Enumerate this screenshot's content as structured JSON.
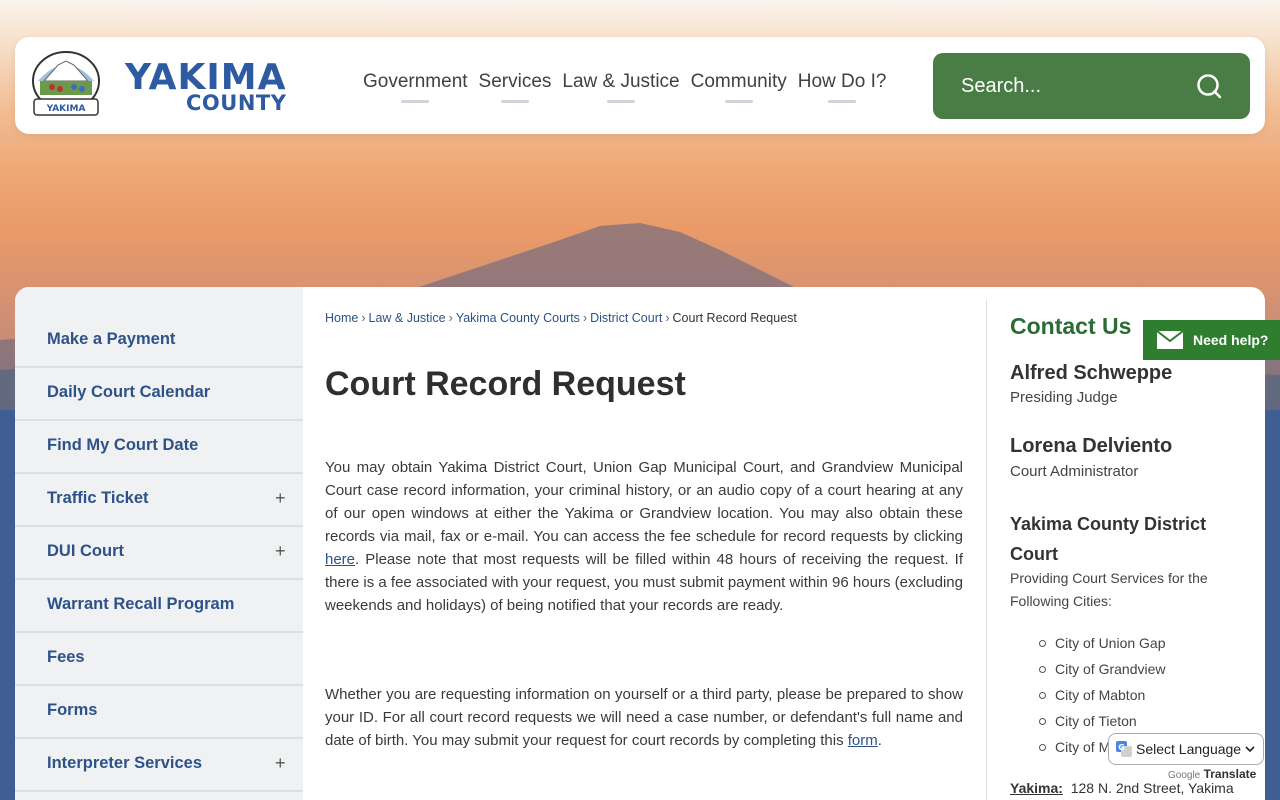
{
  "header": {
    "logo_word1": "YAKIMA",
    "logo_word2": "COUNTY",
    "logo_badge_text": "YAKIMA",
    "nav": [
      {
        "label": "Government"
      },
      {
        "label": "Services"
      },
      {
        "label": "Law & Justice"
      },
      {
        "label": "Community"
      },
      {
        "label": "How Do I?"
      }
    ],
    "search_placeholder": "Search..."
  },
  "sidebar": {
    "items": [
      {
        "label": "Make a Payment",
        "expandable": false
      },
      {
        "label": "Daily Court Calendar",
        "expandable": false
      },
      {
        "label": "Find My Court Date",
        "expandable": false
      },
      {
        "label": "Traffic Ticket",
        "expandable": true
      },
      {
        "label": "DUI Court",
        "expandable": true
      },
      {
        "label": "Warrant Recall Program",
        "expandable": false
      },
      {
        "label": "Fees",
        "expandable": false
      },
      {
        "label": "Forms",
        "expandable": false
      },
      {
        "label": "Interpreter Services",
        "expandable": true
      }
    ],
    "expand_symbol": "+"
  },
  "breadcrumb": {
    "items": [
      "Home",
      "Law & Justice",
      "Yakima County Courts",
      "District Court"
    ],
    "current": "Court Record Request",
    "separator": "›"
  },
  "main": {
    "title": "Court Record Request",
    "para1_a": "You may obtain Yakima District Court, Union Gap Municipal Court, and Grandview Municipal Court case record information, your criminal history, or an audio copy of a court hearing at any of our open windows at either the Yakima or Grandview location. You may also obtain these records via mail, fax or e-mail.  You can access the fee schedule for record requests by clicking ",
    "para1_link": "here",
    "para1_b": ".  Please note that most requests will be filled within 48 hours of receiving the request.  If there is a fee associated with your request, you must submit payment within 96 hours (excluding weekends and holidays) of being notified that your records are ready.",
    "para2_a": "Whether you are requesting information on yourself or a third party, please be prepared to show your ID.  For all court record requests we will need a case number, or defendant's full name and date of birth. You may submit your request for court records by completing this ",
    "para2_link": "form",
    "para2_b": "."
  },
  "contact": {
    "title": "Contact Us",
    "people": [
      {
        "name": "Alfred Schweppe",
        "role": "Presiding Judge"
      },
      {
        "name": "Lorena Delviento",
        "role": "Court Administrator"
      }
    ],
    "org": "Yakima County District Court",
    "desc": "Providing Court Services for the Following Cities:",
    "cities": [
      "City of Union Gap",
      "City of Grandview",
      "City of Mabton",
      "City of Tieton",
      "City of M"
    ],
    "address_label": "Yakima:",
    "address": "128 N. 2nd Street, Yakima"
  },
  "help_tab": {
    "label": "Need help?"
  },
  "translate": {
    "select_label": "Select Language",
    "credit_prefix": "Google",
    "credit": "Translate"
  },
  "colors": {
    "brand_blue": "#2d5aa0",
    "search_green": "#4a7c45",
    "contact_green": "#2c6b35",
    "help_green": "#2f7d2f",
    "sidebar_link": "#2d5289"
  }
}
